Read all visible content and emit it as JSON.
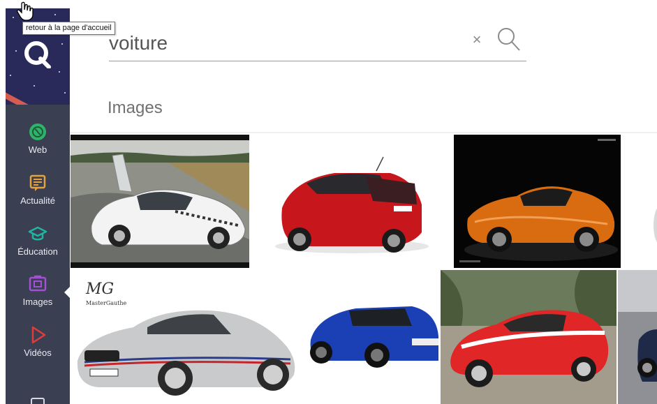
{
  "tooltip": {
    "text": "retour à la page d'accueil"
  },
  "search": {
    "value": "voiture",
    "clear_label": "×"
  },
  "section": {
    "title": "Images"
  },
  "sidebar": {
    "items": [
      {
        "label": "Web",
        "icon": "globe-icon",
        "color": "#2fb36a"
      },
      {
        "label": "Actualité",
        "icon": "news-icon",
        "color": "#e8a13a"
      },
      {
        "label": "Éducation",
        "icon": "graduation-cap-icon",
        "color": "#22b3a1"
      },
      {
        "label": "Images",
        "icon": "image-icon",
        "color": "#a44fd6",
        "active": true
      },
      {
        "label": "Vidéos",
        "icon": "play-icon",
        "color": "#e03c3c"
      }
    ]
  },
  "results": {
    "row1": [
      {
        "subject": "white-porsche-icon",
        "watermark": ""
      },
      {
        "subject": "red-peugeot-icon",
        "watermark": ""
      },
      {
        "subject": "orange-mclaren-icon",
        "watermark": ""
      }
    ],
    "row2": [
      {
        "subject": "silver-bmw-icon",
        "watermark": "MG",
        "watermark_sub": "MasterGauthe"
      },
      {
        "subject": "blue-vw-icon",
        "watermark": ""
      },
      {
        "subject": "red-viper-icon",
        "watermark": ""
      }
    ]
  }
}
